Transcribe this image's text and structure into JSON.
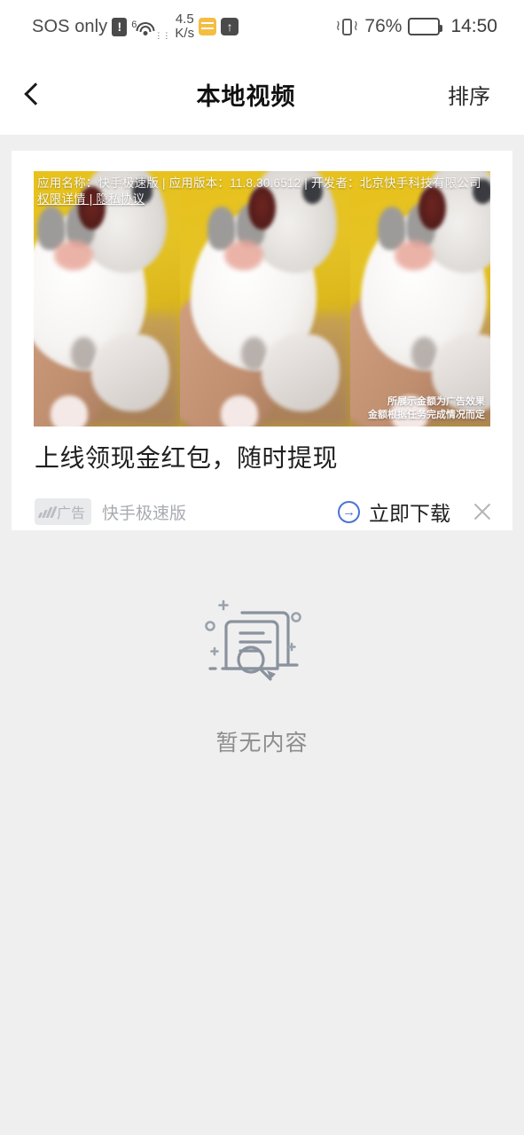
{
  "status_bar": {
    "carrier": "SOS only",
    "sim_alert_icon": "sim-alert-icon",
    "wifi_generation": "6",
    "wifi_icon": "wifi-icon",
    "network_speed": "4.5",
    "network_speed_unit": "K/s",
    "app_icon_yellow": "notification-app-icon",
    "upload_icon": "upload-arrow-icon",
    "vibrate_icon": "vibrate-mode-icon",
    "battery_percent": "76%",
    "battery_level": 76,
    "battery_icon": "battery-icon",
    "time": "14:50"
  },
  "header": {
    "back_icon": "back-chevron-icon",
    "title": "本地视频",
    "sort_label": "排序"
  },
  "ad_card": {
    "overlay_line1": "应用名称：快手极速版 | 应用版本：11.8.30.6512 | 开发者：北京快手科技有限公司",
    "overlay_line2": "权限详情 | 隐私协议",
    "disclaimer_line1": "所展示金额为广告效果",
    "disclaimer_line2": "金额根据任务完成情况而定",
    "title": "上线领现金红包，随时提现",
    "badge_label": "广告",
    "brand": "快手极速版",
    "download_label": "立即下载",
    "download_icon": "arrow-right-circle-icon",
    "close_icon": "close-icon",
    "thumbnail_alt": "kitten-video-thumbnail"
  },
  "empty_state": {
    "icon": "empty-documents-search-icon",
    "text": "暂无内容"
  },
  "colors": {
    "page_background": "#efefef",
    "card_background": "#ffffff",
    "accent_blue": "#4a72d6",
    "muted_text": "#8d8d8d",
    "status_icon": "#4a4a4a",
    "badge_background": "#e9eaec"
  }
}
